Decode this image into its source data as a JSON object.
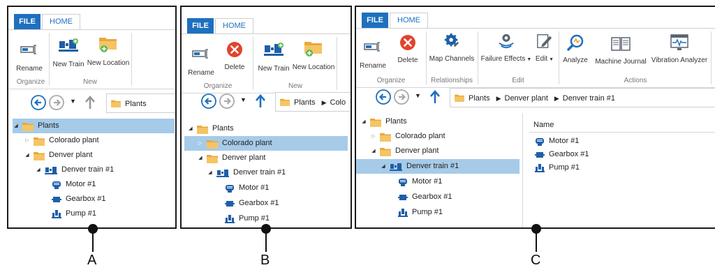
{
  "tabs": {
    "file": "FILE",
    "home": "HOME"
  },
  "buttons": {
    "rename": "Rename",
    "delete": "Delete",
    "new_train": "New Train",
    "new_location": "New Location",
    "map_channels": "Map Channels",
    "failure_effects": "Failure Effects",
    "edit": "Edit",
    "analyze": "Analyze",
    "machine_journal": "Machine Journal",
    "vibration_analyzer": "Vibration Analyzer"
  },
  "groups": {
    "organize": "Organize",
    "new": "New",
    "relationships": "Relationships",
    "edit": "Edit",
    "actions": "Actions"
  },
  "address": {
    "plants": "Plants",
    "colo": "Colo",
    "denver_plant": "Denver plant",
    "denver_train": "Denver train #1"
  },
  "tree": {
    "plants": "Plants",
    "colorado_plant": "Colorado plant",
    "denver_plant": "Denver plant",
    "denver_train": "Denver train #1",
    "motor": "Motor #1",
    "gearbox": "Gearbox #1",
    "pump": "Pump #1"
  },
  "list": {
    "name_header": "Name",
    "items": [
      "Motor #1",
      "Gearbox #1",
      "Pump #1"
    ]
  },
  "callouts": {
    "a": "A",
    "b": "B",
    "c": "C"
  },
  "colors": {
    "accent": "#1e70bf",
    "selection": "#a6cbe9",
    "folder": "#f0b84a"
  }
}
